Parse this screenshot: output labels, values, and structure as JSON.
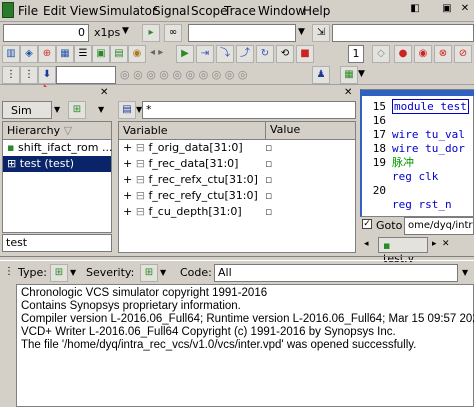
{
  "menu": [
    {
      "label": "File",
      "ul": "F"
    },
    {
      "label": "Edit",
      "ul": "E"
    },
    {
      "label": "View",
      "ul": "V"
    },
    {
      "label": "Simulator",
      "ul": "S"
    },
    {
      "label": "Signal",
      "ul": "S"
    },
    {
      "label": "Scope",
      "ul": "S"
    },
    {
      "label": "Trace",
      "ul": "T"
    },
    {
      "label": "Window",
      "ul": "W"
    },
    {
      "label": "Help",
      "ul": "H"
    }
  ],
  "toolbar1": {
    "time_value": "0",
    "time_unit": "x1ps",
    "number_field": "1"
  },
  "left_panel": {
    "tab_label": "Sim",
    "header": "Hierarchy",
    "items": [
      {
        "label": "shift_ifact_rom ..."
      },
      {
        "label": "test (test)"
      }
    ],
    "search_value": "test"
  },
  "variable_panel": {
    "filter_value": "*",
    "col_variable": "Variable",
    "col_value": "Value",
    "rows": [
      "f_orig_data[31:0]",
      "f_rec_data[31:0]",
      "f_rec_refx_ctu[31:0]",
      "f_rec_refy_ctu[31:0]",
      "f_cu_depth[31:0]"
    ]
  },
  "source_panel": {
    "lines": [
      {
        "num": "15",
        "code": "module test",
        "color": "#0000cc",
        "boxed": true
      },
      {
        "num": "16",
        "code": "",
        "color": "#000000"
      },
      {
        "num": "17",
        "code": "wire tu_val",
        "color": "#0000cc"
      },
      {
        "num": "18",
        "code": "wire tu_dor",
        "color": "#0000cc"
      },
      {
        "num": "19",
        "code": "脉冲",
        "color": "#009900"
      },
      {
        "num": "",
        "code": "reg clk",
        "color": "#0000cc"
      },
      {
        "num": "20",
        "code": "",
        "color": "#000000"
      },
      {
        "num": "",
        "code": "reg rst_n",
        "color": "#0000cc"
      }
    ],
    "goto_label": "Goto",
    "path_value": "ome/dyq/intra",
    "tab_label": "test.v"
  },
  "message_bar": {
    "type_label": "Type:",
    "severity_label": "Severity:",
    "code_label": "Code:",
    "code_value": "All"
  },
  "console": {
    "lines": [
      "Chronologic VCS simulator copyright 1991-2016",
      "Contains Synopsys proprietary information.",
      "Compiler version L-2016.06_Full64; Runtime version L-2016.06_Full64;  Mar 15 09:57 2022",
      "VCD+ Writer L-2016.06_Full64 Copyright (c) 1991-2016 by Synopsys Inc.",
      "The file '/home/dyq/intra_rec_vcs/v1.0/vcs/inter.vpd' was opened successfully."
    ]
  },
  "colors": {
    "selection": "#0a246a",
    "annotation_arrow": "#e53935",
    "keyword": "#0000cc"
  }
}
